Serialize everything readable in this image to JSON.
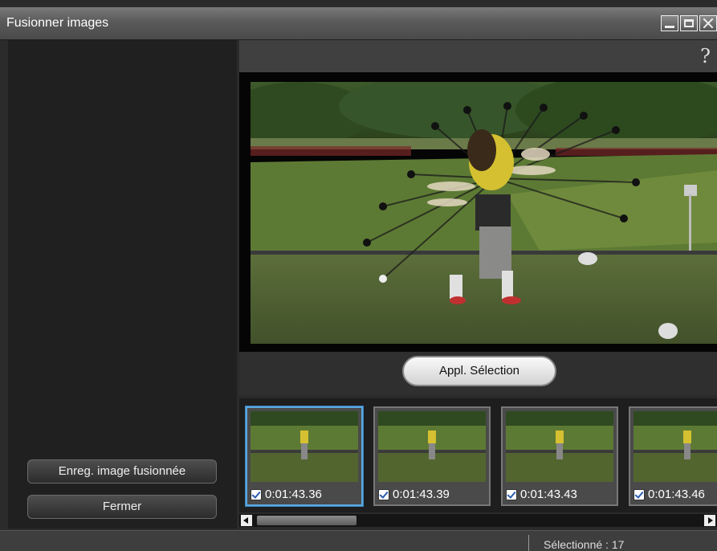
{
  "window": {
    "title": "Fusionner images"
  },
  "left_panel": {
    "save_label": "Enreg. image fusionnée",
    "close_label": "Fermer"
  },
  "help": {
    "label": "?"
  },
  "apply_button": {
    "label": "Appl. Sélection"
  },
  "thumbnails": [
    {
      "time": "0:01:43.36",
      "checked": true,
      "selected": true
    },
    {
      "time": "0:01:43.39",
      "checked": true,
      "selected": false
    },
    {
      "time": "0:01:43.43",
      "checked": true,
      "selected": false
    },
    {
      "time": "0:01:43.46",
      "checked": true,
      "selected": false
    }
  ],
  "status": {
    "text": "Sélectionné : 17"
  },
  "icons": {
    "minimize": "minimize-icon",
    "maximize": "maximize-icon",
    "close": "close-icon",
    "checkbox": "checkbox-checked-icon",
    "scroll_left": "arrow-left-icon",
    "scroll_right": "arrow-right-icon"
  },
  "colors": {
    "selection_border": "#5aa8e0",
    "window_bg": "#2b2b2b"
  }
}
